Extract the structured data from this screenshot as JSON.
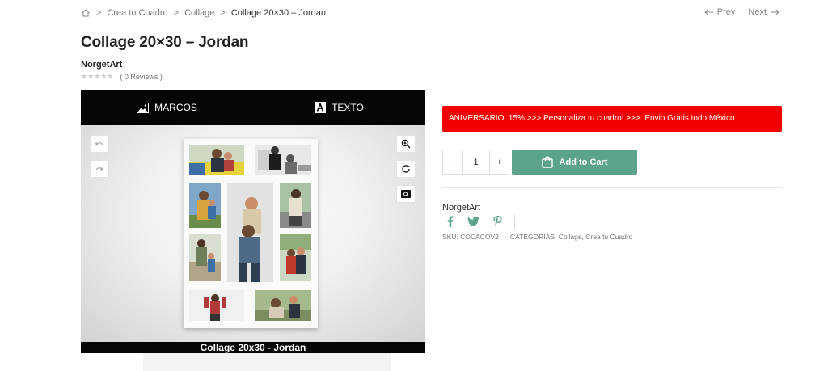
{
  "breadcrumb": {
    "items": [
      "Crea tu Cuadro",
      "Collage"
    ],
    "current": "Collage 20×30 – Jordan"
  },
  "nav": {
    "prev": "Prev",
    "next": "Next"
  },
  "product": {
    "title": "Collage 20×30 – Jordan",
    "brand": "NorgetArt",
    "reviews": "( 0 Reviews )",
    "rating": 0
  },
  "customizer": {
    "tab_frames": "MARCOS",
    "tab_text": "TEXTO",
    "caption": "Collage 20x30 - Jordan"
  },
  "purchase": {
    "promo": "ANIVERSARIO. 15% >>> Personaliza tu cuadro! >>>. Envio Gratis todo México",
    "quantity": "1",
    "add_to_cart": "Add to Cart"
  },
  "meta": {
    "vendor": "NorgetArt",
    "sku": "SKU: COCACOV2",
    "categories": "CATEGORÍAS: Collage, Crea tu Cuadro"
  },
  "colors": {
    "promo_bg": "#f40000",
    "cart_bg": "#5ba48a",
    "social": "#5ba48a"
  }
}
